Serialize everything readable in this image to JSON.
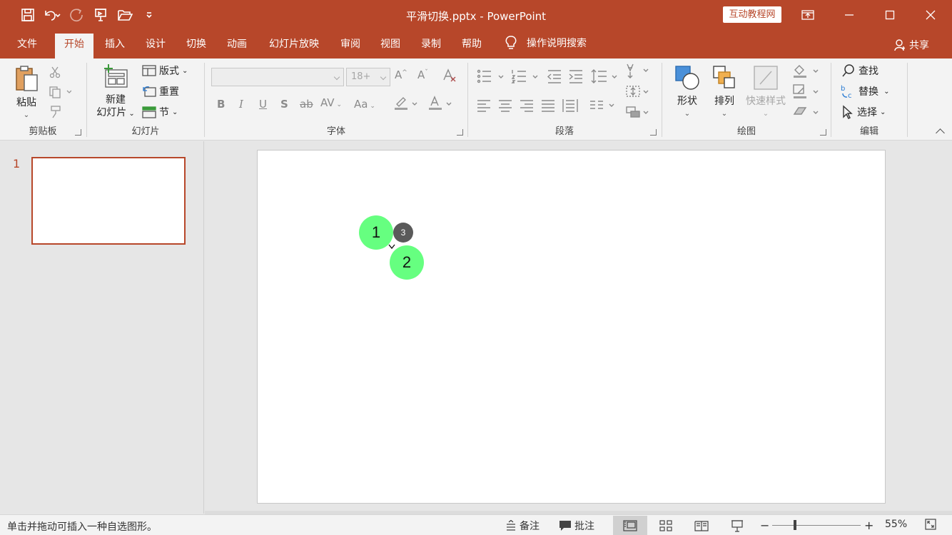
{
  "window": {
    "title": "平滑切换.pptx  -  PowerPoint",
    "badge": "互动教程网"
  },
  "tabs": [
    {
      "label": "文件"
    },
    {
      "label": "开始"
    },
    {
      "label": "插入"
    },
    {
      "label": "设计"
    },
    {
      "label": "切换"
    },
    {
      "label": "动画"
    },
    {
      "label": "幻灯片放映"
    },
    {
      "label": "审阅"
    },
    {
      "label": "视图"
    },
    {
      "label": "录制"
    },
    {
      "label": "帮助"
    }
  ],
  "active_tab": "开始",
  "tell_me": "操作说明搜索",
  "share": "共享",
  "ribbon": {
    "clipboard": {
      "label": "剪贴板",
      "paste": "粘贴"
    },
    "slides": {
      "label": "幻灯片",
      "new_slide_1": "新建",
      "new_slide_2": "幻灯片",
      "layout": "版式",
      "reset": "重置",
      "section": "节"
    },
    "font": {
      "label": "字体",
      "size_placeholder": "18+"
    },
    "paragraph": {
      "label": "段落"
    },
    "drawing": {
      "label": "绘图",
      "shapes": "形状",
      "arrange": "排列",
      "quick_styles": "快速样式"
    },
    "editing": {
      "label": "编辑",
      "find": "查找",
      "replace": "替换",
      "select": "选择"
    }
  },
  "thumbnail": {
    "number": "1"
  },
  "markers": [
    {
      "label": "1"
    },
    {
      "label": "2"
    },
    {
      "label": "3"
    }
  ],
  "status": {
    "hint": "单击并拖动可插入一种自选图形。",
    "notes": "备注",
    "comments": "批注",
    "zoom": "55%"
  },
  "colors": {
    "accent": "#b7472a",
    "marker": "#66ff80"
  }
}
